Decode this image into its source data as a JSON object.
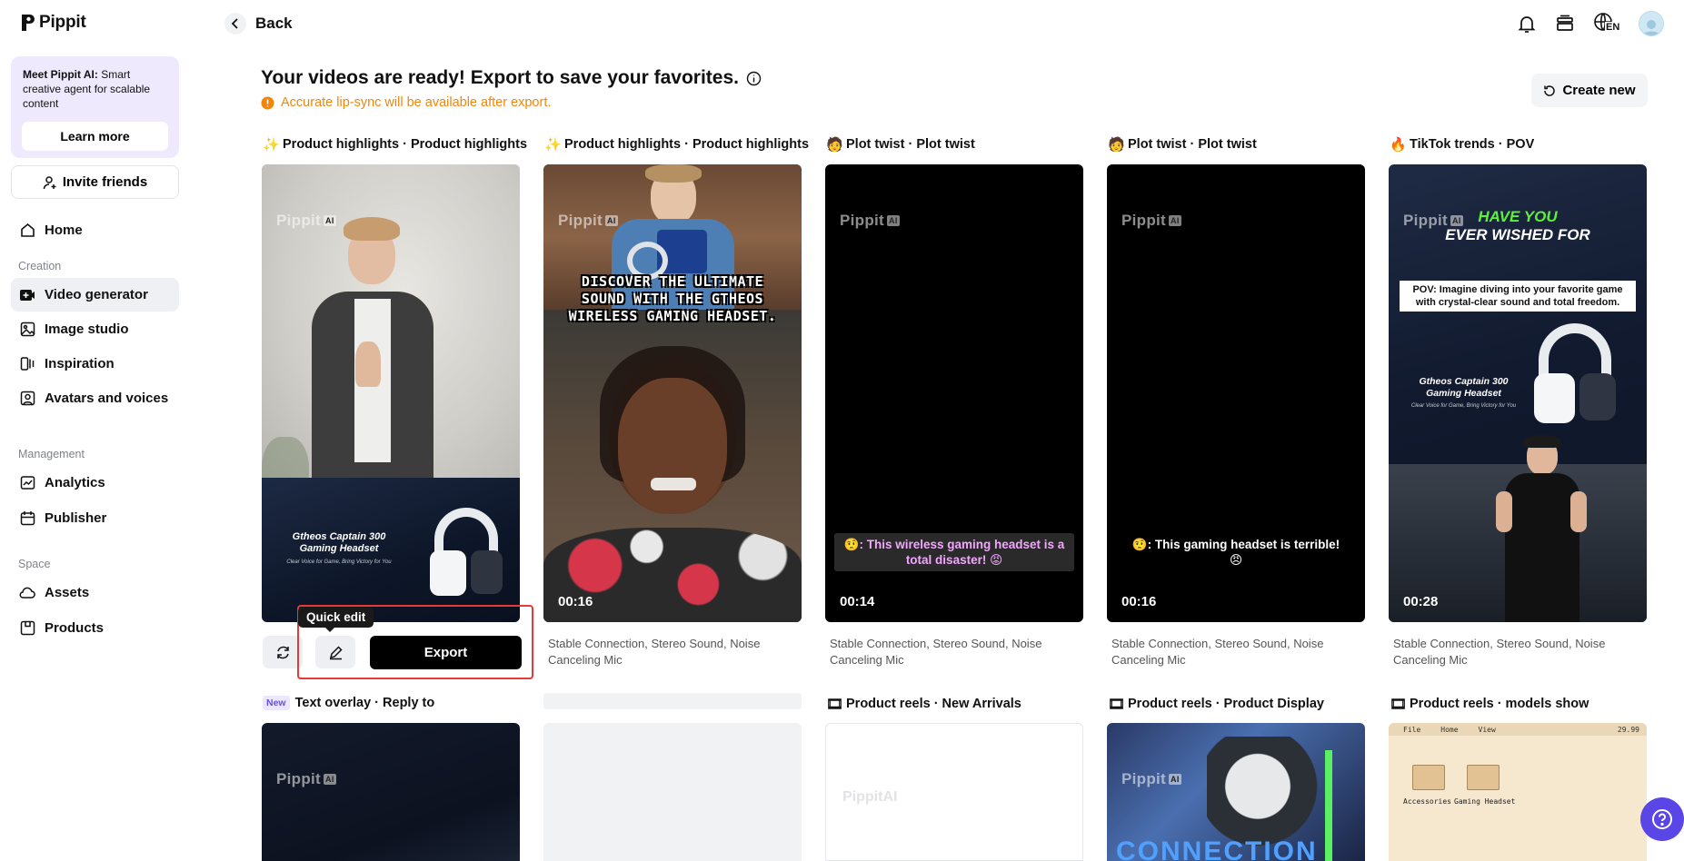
{
  "app": {
    "name": "Pippit"
  },
  "sidebar": {
    "promo": {
      "bold": "Meet Pippit AI:",
      "text": " Smart creative agent for scalable content",
      "button": "Learn more"
    },
    "invite": "Invite friends",
    "home": "Home",
    "sections": {
      "creation": "Creation",
      "management": "Management",
      "space": "Space"
    },
    "items": {
      "video_generator": "Video generator",
      "image_studio": "Image studio",
      "inspiration": "Inspiration",
      "avatars": "Avatars and voices",
      "analytics": "Analytics",
      "publisher": "Publisher",
      "assets": "Assets",
      "products": "Products"
    }
  },
  "header": {
    "back": "Back",
    "lang": "EN"
  },
  "main": {
    "title": "Your videos are ready! Export to save your favorites.",
    "warning": "Accurate lip-sync will be available after export.",
    "create_new": "Create new",
    "watermark": "Pippit",
    "watermark_ai": "AI",
    "cards": [
      {
        "label": "Product highlights · Product highlights",
        "emoji": "✨",
        "product_title": "Gtheos Captain 300 Gaming Headset",
        "product_sub": "Clear Voice for Game, Bring Victory for You"
      },
      {
        "label": "Product highlights · Product highlights",
        "emoji": "✨",
        "overlay": "DISCOVER THE ULTIMATE SOUND WITH THE GTHEOS WIRELESS GAMING HEADSET.",
        "duration": "00:16",
        "desc": "Stable Connection, Stereo Sound, Noise Canceling Mic"
      },
      {
        "label": "Plot twist · Plot twist",
        "emoji": "🧑",
        "subtitle": "🤨: This wireless gaming headset is a total disaster! 😡",
        "duration": "00:14",
        "desc": "Stable Connection, Stereo Sound, Noise Canceling Mic"
      },
      {
        "label": "Plot twist · Plot twist",
        "emoji": "🧑",
        "subtitle": "🤨: This gaming headset is terrible! 😠",
        "duration": "00:16",
        "desc": "Stable Connection, Stereo Sound, Noise Canceling Mic"
      },
      {
        "label": "TikTok trends · POV",
        "emoji": "🔥",
        "headline_1": "HAVE YOU",
        "headline_2": "EVER WISHED FOR",
        "pov": "POV: Imagine diving into your favorite game with crystal-clear sound and total freedom.",
        "product_title": "Gtheos Captain 300 Gaming Headset",
        "product_sub": "Clear Voice for Game, Bring Victory for You",
        "duration": "00:28",
        "desc": "Stable Connection, Stereo Sound, Noise Canceling Mic"
      }
    ],
    "actions": {
      "tooltip": "Quick edit",
      "export": "Export"
    },
    "row2": [
      {
        "badge": "New",
        "label": "Text overlay · Reply to"
      },
      {
        "label": ""
      },
      {
        "emoji": "🎞",
        "label": "Product reels · New Arrivals"
      },
      {
        "emoji": "🎞",
        "label": "Product reels · Product Display",
        "overlay": "CONNECTION"
      },
      {
        "emoji": "🎞",
        "label": "Product reels · models show",
        "menu": [
          "File",
          "Home",
          "View"
        ],
        "price": "29.99",
        "folders": [
          "Accessories",
          "Gaming Headset"
        ]
      }
    ]
  },
  "colors": {
    "accent": "#5a45e6",
    "warning": "#f0860d",
    "highlight_border": "#e33a3a"
  }
}
